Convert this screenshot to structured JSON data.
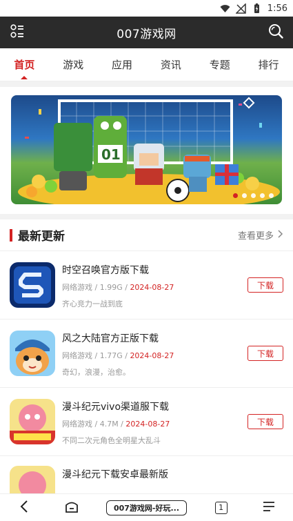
{
  "status": {
    "time": "1:56"
  },
  "header": {
    "title": "007游戏网"
  },
  "tabs": [
    {
      "label": "首页",
      "active": true
    },
    {
      "label": "游戏",
      "active": false
    },
    {
      "label": "应用",
      "active": false
    },
    {
      "label": "资讯",
      "active": false
    },
    {
      "label": "专题",
      "active": false
    },
    {
      "label": "排行",
      "active": false
    }
  ],
  "banner": {
    "slide_count": 5,
    "active_index": 0
  },
  "section": {
    "title": "最新更新",
    "more": "查看更多"
  },
  "apps": [
    {
      "name": "时空召唤官方版下载",
      "category": "网络游戏",
      "size": "1.99G",
      "date": "2024-08-27",
      "desc": "齐心竞力一战到底",
      "button": "下载"
    },
    {
      "name": "风之大陆官方正版下载",
      "category": "网络游戏",
      "size": "1.77G",
      "date": "2024-08-27",
      "desc": "奇幻，浪漫，治愈。",
      "button": "下载"
    },
    {
      "name": "漫斗纪元vivo渠道服下载",
      "category": "网络游戏",
      "size": "4.7M",
      "date": "2024-08-27",
      "desc": "不同二次元角色全明星大乱斗",
      "button": "下载"
    },
    {
      "name": "漫斗纪元下载安卓最新版",
      "category": "",
      "size": "",
      "date": "",
      "desc": "",
      "button": ""
    }
  ],
  "bottom_nav": {
    "url_text": "007游戏网-好玩...",
    "tab_count": "1"
  },
  "colors": {
    "accent": "#d32222",
    "header_bg": "#2b2b2b"
  }
}
